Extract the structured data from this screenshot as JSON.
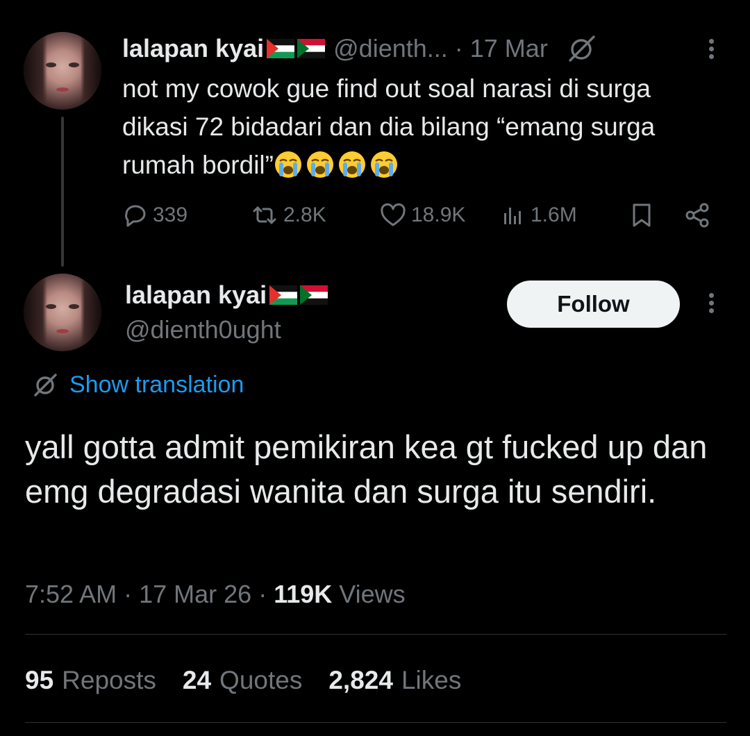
{
  "tweet1": {
    "display_name": "lalapan kyai",
    "handle": "@dienth...",
    "separator": "·",
    "date": "17 Mar",
    "text": "not my cowok gue find out soal narasi di surga dikasi 72 bidadari dan dia bilang “emang surga rumah bordil”",
    "emojis": [
      "loudly-crying-face",
      "loudly-crying-face",
      "loudly-crying-face",
      "loudly-crying-face"
    ],
    "flags": [
      "palestine-flag",
      "sudan-flag"
    ],
    "actions": {
      "replies": "339",
      "reposts": "2.8K",
      "likes": "18.9K",
      "views": "1.6M"
    }
  },
  "tweet2": {
    "display_name": "lalapan kyai",
    "handle": "@dienth0ught",
    "follow_label": "Follow",
    "translate_label": "Show translation",
    "text": "yall gotta admit pemikiran kea gt fucked up dan emg degradasi wanita dan surga itu sendiri.",
    "time": "7:52 AM",
    "separator": "·",
    "date": "17 Mar 26",
    "views_count": "119K",
    "views_label": "Views",
    "stats": {
      "reposts_count": "95",
      "reposts_label": "Reposts",
      "quotes_count": "24",
      "quotes_label": "Quotes",
      "likes_count": "2,824",
      "likes_label": "Likes"
    }
  },
  "colors": {
    "background": "#000000",
    "text": "#e7e9ea",
    "secondary": "#71767b",
    "link": "#1d9bf0",
    "divider": "#2f3336",
    "follow_bg": "#eff3f4"
  }
}
